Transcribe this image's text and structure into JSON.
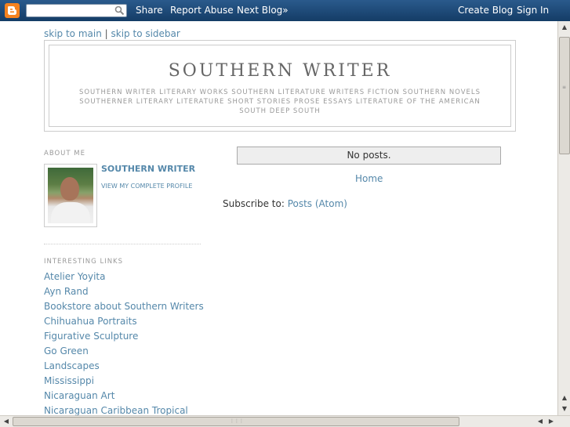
{
  "navbar": {
    "search_placeholder": "",
    "share": "Share",
    "report_abuse": "Report Abuse",
    "next_blog": "Next Blog»",
    "create_blog": "Create Blog",
    "sign_in": "Sign In"
  },
  "skip": {
    "main": "skip to main",
    "separator": "|",
    "sidebar": "skip to sidebar"
  },
  "header": {
    "title": "SOUTHERN WRITER",
    "description": "SOUTHERN WRITER LITERARY WORKS SOUTHERN LITERATURE WRITERS FICTION SOUTHERN NOVELS SOUTHERNER LITERARY LITERATURE SHORT STORIES PROSE ESSAYS LITERATURE OF THE AMERICAN SOUTH DEEP SOUTH"
  },
  "sidebar": {
    "about_title": "ABOUT ME",
    "profile_name": "SOUTHERN WRITER",
    "profile_link": "VIEW MY COMPLETE PROFILE",
    "links_title": "INTERESTING LINKS",
    "links": [
      "Atelier Yoyita",
      "Ayn Rand",
      "Bookstore about Southern Writers",
      "Chihuahua Portraits",
      "Figurative Sculpture",
      "Go Green",
      "Landscapes",
      "Mississippi",
      "Nicaraguan Art",
      "Nicaraguan Caribbean Tropical"
    ]
  },
  "main": {
    "no_posts": "No posts.",
    "home": "Home",
    "subscribe_label": "Subscribe to:",
    "subscribe_link": "Posts (Atom)"
  },
  "colors": {
    "navbar": "#1d4b7a",
    "link": "#5588aa",
    "blogger_orange": "#f5821f"
  }
}
